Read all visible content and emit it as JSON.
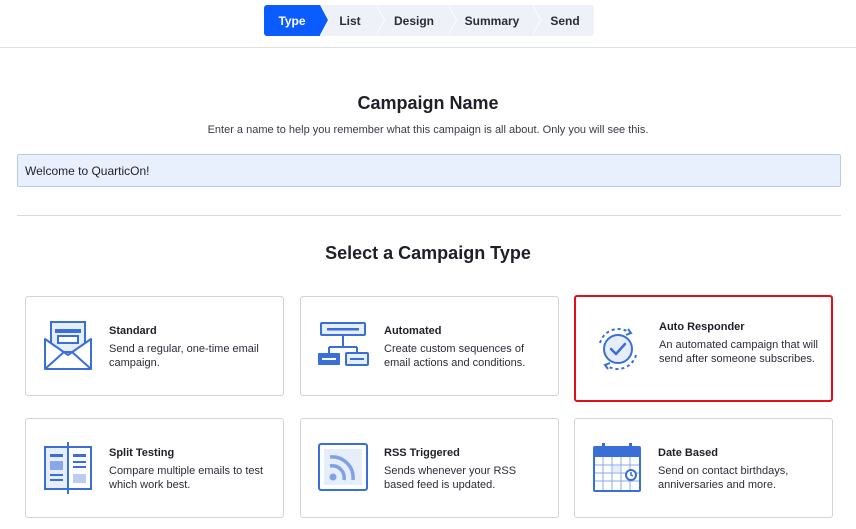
{
  "stepper": {
    "steps": [
      {
        "label": "Type"
      },
      {
        "label": "List"
      },
      {
        "label": "Design"
      },
      {
        "label": "Summary"
      },
      {
        "label": "Send"
      }
    ],
    "active": "Type",
    "accent_color": "#0a5cff"
  },
  "campaign_name": {
    "heading": "Campaign Name",
    "hint": "Enter a name to help you remember what this campaign is all about. Only you will see this.",
    "value": "Welcome to QuarticOn!"
  },
  "campaign_type": {
    "heading": "Select a Campaign Type",
    "selected": "Auto Responder",
    "selected_border_color": "#e0101a",
    "cards": [
      {
        "title": "Standard",
        "description": "Send a regular, one-time email campaign.",
        "icon": "envelope-icon"
      },
      {
        "title": "Automated",
        "description": "Create custom sequences of email actions and conditions.",
        "icon": "workflow-icon"
      },
      {
        "title": "Auto Responder",
        "description": "An automated campaign that will send after someone subscribes.",
        "icon": "autoresponder-icon"
      },
      {
        "title": "Split Testing",
        "description": "Compare multiple emails to test which work best.",
        "icon": "split-test-icon"
      },
      {
        "title": "RSS Triggered",
        "description": "Sends whenever your RSS based feed is updated.",
        "icon": "rss-icon"
      },
      {
        "title": "Date Based",
        "description": "Send on contact birthdays, anniversaries and more.",
        "icon": "calendar-icon"
      }
    ]
  }
}
